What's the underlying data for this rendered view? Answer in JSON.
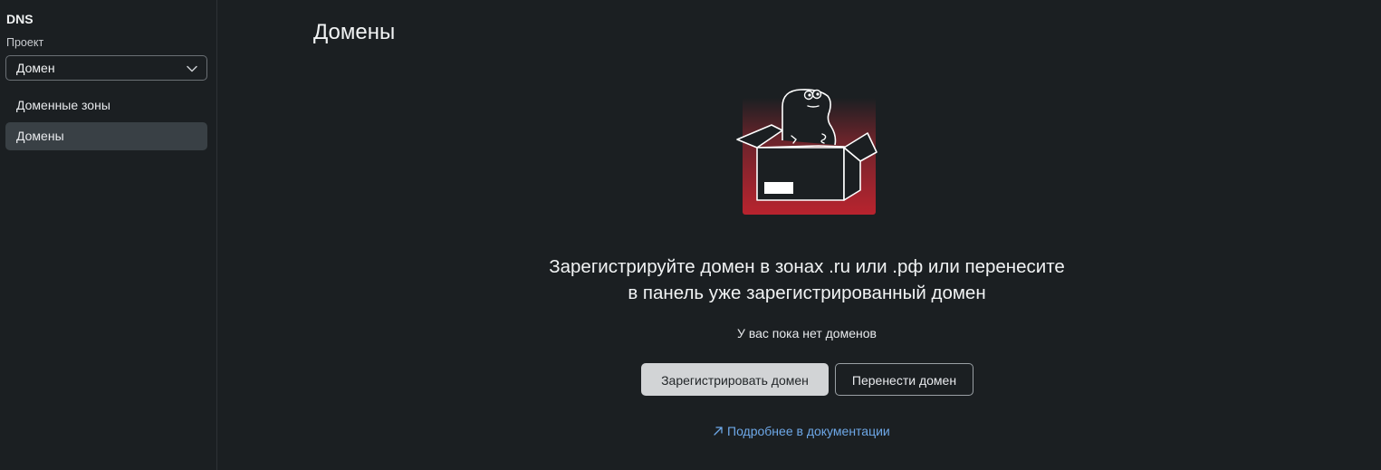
{
  "sidebar": {
    "title": "DNS",
    "project_label": "Проект",
    "project_select": {
      "value": "Домен"
    },
    "items": [
      {
        "label": "Доменные зоны",
        "active": false
      },
      {
        "label": "Домены",
        "active": true
      }
    ]
  },
  "main": {
    "title": "Домены",
    "empty_state": {
      "headline_line1": "Зарегистрируйте домен в зонах .ru или .рф или перенесите",
      "headline_line2": "в панель уже зарегистрированный домен",
      "subtext": "У вас пока нет доменов",
      "primary_button": "Зарегистрировать домен",
      "secondary_button": "Перенести домен",
      "doc_link": "Подробнее в документации"
    }
  },
  "colors": {
    "background": "#1b1f22",
    "accent_red": "#c62a35",
    "link": "#6ea8e8"
  },
  "icons": [
    "chevron-down-icon",
    "external-arrow-icon",
    "dino-box-illustration"
  ]
}
